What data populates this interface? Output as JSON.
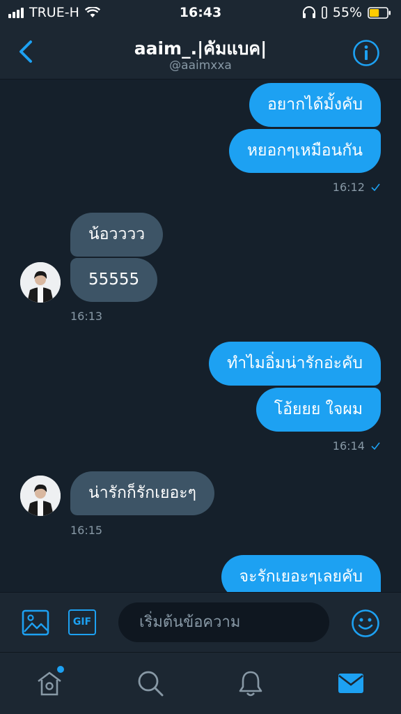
{
  "status_bar": {
    "carrier": "TRUE-H",
    "time": "16:43",
    "battery": "55%",
    "battery_level": 0.55
  },
  "header": {
    "title": "aaim_.|คัมแบค|",
    "handle": "@aaimxxa",
    "back_icon": "chevron-left-icon",
    "info_icon": "info-icon"
  },
  "messages": [
    {
      "direction": "out",
      "text": "อยากได้มั้งคับ"
    },
    {
      "direction": "out",
      "text": "หยอกๆเหมือนกัน",
      "time": "16:12"
    },
    {
      "direction": "in",
      "text": "น้อวววว"
    },
    {
      "direction": "in",
      "text": "55555",
      "time": "16:13"
    },
    {
      "direction": "out",
      "text": "ทำไมอิ่มน่ารักอ่ะคับ"
    },
    {
      "direction": "out",
      "text": "โอ้ยยย ใจผม",
      "time": "16:14"
    },
    {
      "direction": "in",
      "text": "น่ารักก็รักเยอะๆ",
      "time": "16:15"
    },
    {
      "direction": "out",
      "text": "จะรักเยอะๆเลยคับ"
    }
  ],
  "composer": {
    "placeholder": "เริ่มต้นข้อความ",
    "gif_label": "GIF",
    "icons": [
      "image-icon",
      "gif-icon",
      "emoji-icon"
    ]
  },
  "tabs": [
    "home-icon",
    "search-icon",
    "notifications-icon",
    "messages-icon"
  ],
  "colors": {
    "background": "#15202b",
    "bar": "#1c2732",
    "accent": "#1da1f2",
    "incoming_bubble": "#3d5466",
    "muted_text": "#8899a6"
  }
}
